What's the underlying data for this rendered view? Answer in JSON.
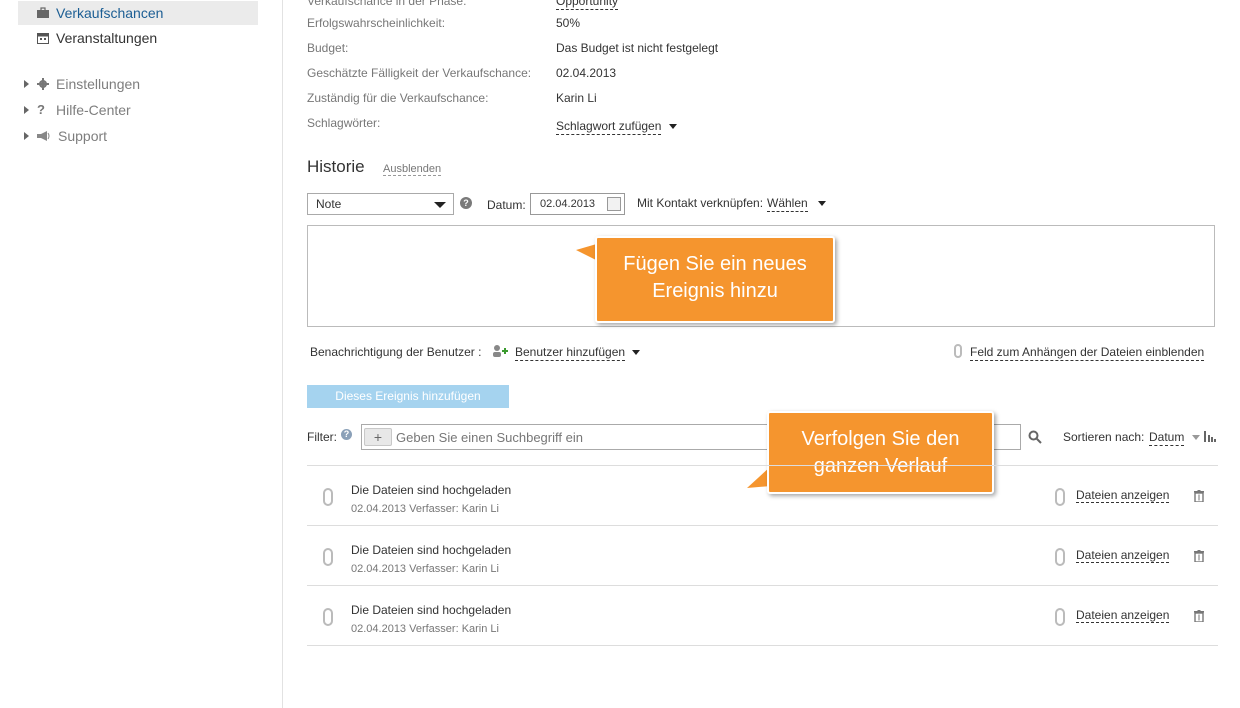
{
  "sidebar": {
    "items": [
      {
        "label": "Verkaufschancen",
        "icon": "briefcase-icon"
      },
      {
        "label": "Veranstaltungen",
        "icon": "calendar-icon"
      },
      {
        "label": "Einstellungen",
        "icon": "gear-icon"
      },
      {
        "label": "Hilfe-Center",
        "icon": "question-icon"
      },
      {
        "label": "Support",
        "icon": "megaphone-icon"
      }
    ]
  },
  "details": {
    "partial_label": "Verkaufschance in der Phase:",
    "partial_value": "Opportunity",
    "rows": [
      {
        "label": "Erfolgswahrscheinlichkeit:",
        "value": "50%"
      },
      {
        "label": "Budget:",
        "value": "Das Budget ist nicht festgelegt"
      },
      {
        "label": "Geschätzte Fälligkeit der Verkaufschance:",
        "value": "02.04.2013"
      },
      {
        "label": "Zuständig für die Verkaufschance:",
        "value": "Karin Li"
      },
      {
        "label": "Schlagwörter:",
        "value": "Schlagwort zufügen"
      }
    ]
  },
  "history": {
    "title": "Historie",
    "hide_link": "Ausblenden",
    "type_select": "Note",
    "date_label": "Datum:",
    "date_value": "02.04.2013",
    "contact_label": "Mit Kontakt verknüpfen:",
    "contact_value": "Wählen",
    "notify_label": "Benachrichtigung der Benutzer :",
    "add_users": "Benutzer hinzufügen",
    "attach_link": "Feld zum Anhängen der Dateien einblenden",
    "add_event_button": "Dieses Ereignis hinzufügen",
    "filter_label": "Filter:",
    "search_placeholder": "Geben Sie einen Suchbegriff ein",
    "sort_label": "Sortieren nach:",
    "sort_value": "Datum",
    "entries": [
      {
        "title": "Die Dateien sind hochgeladen",
        "meta": "02.04.2013 Verfasser: Karin Li",
        "action": "Dateien anzeigen"
      },
      {
        "title": "Die Dateien sind hochgeladen",
        "meta": "02.04.2013 Verfasser: Karin Li",
        "action": "Dateien anzeigen"
      },
      {
        "title": "Die Dateien sind hochgeladen",
        "meta": "02.04.2013 Verfasser: Karin Li",
        "action": "Dateien anzeigen"
      }
    ]
  },
  "callouts": {
    "add_event": "Fügen Sie ein neues Ereignis hinzu",
    "track_history": "Verfolgen Sie den ganzen Verlauf"
  },
  "colors": {
    "accent": "#1c5e94",
    "callout": "#f5952e",
    "disabled_button": "#a5d3ef"
  }
}
